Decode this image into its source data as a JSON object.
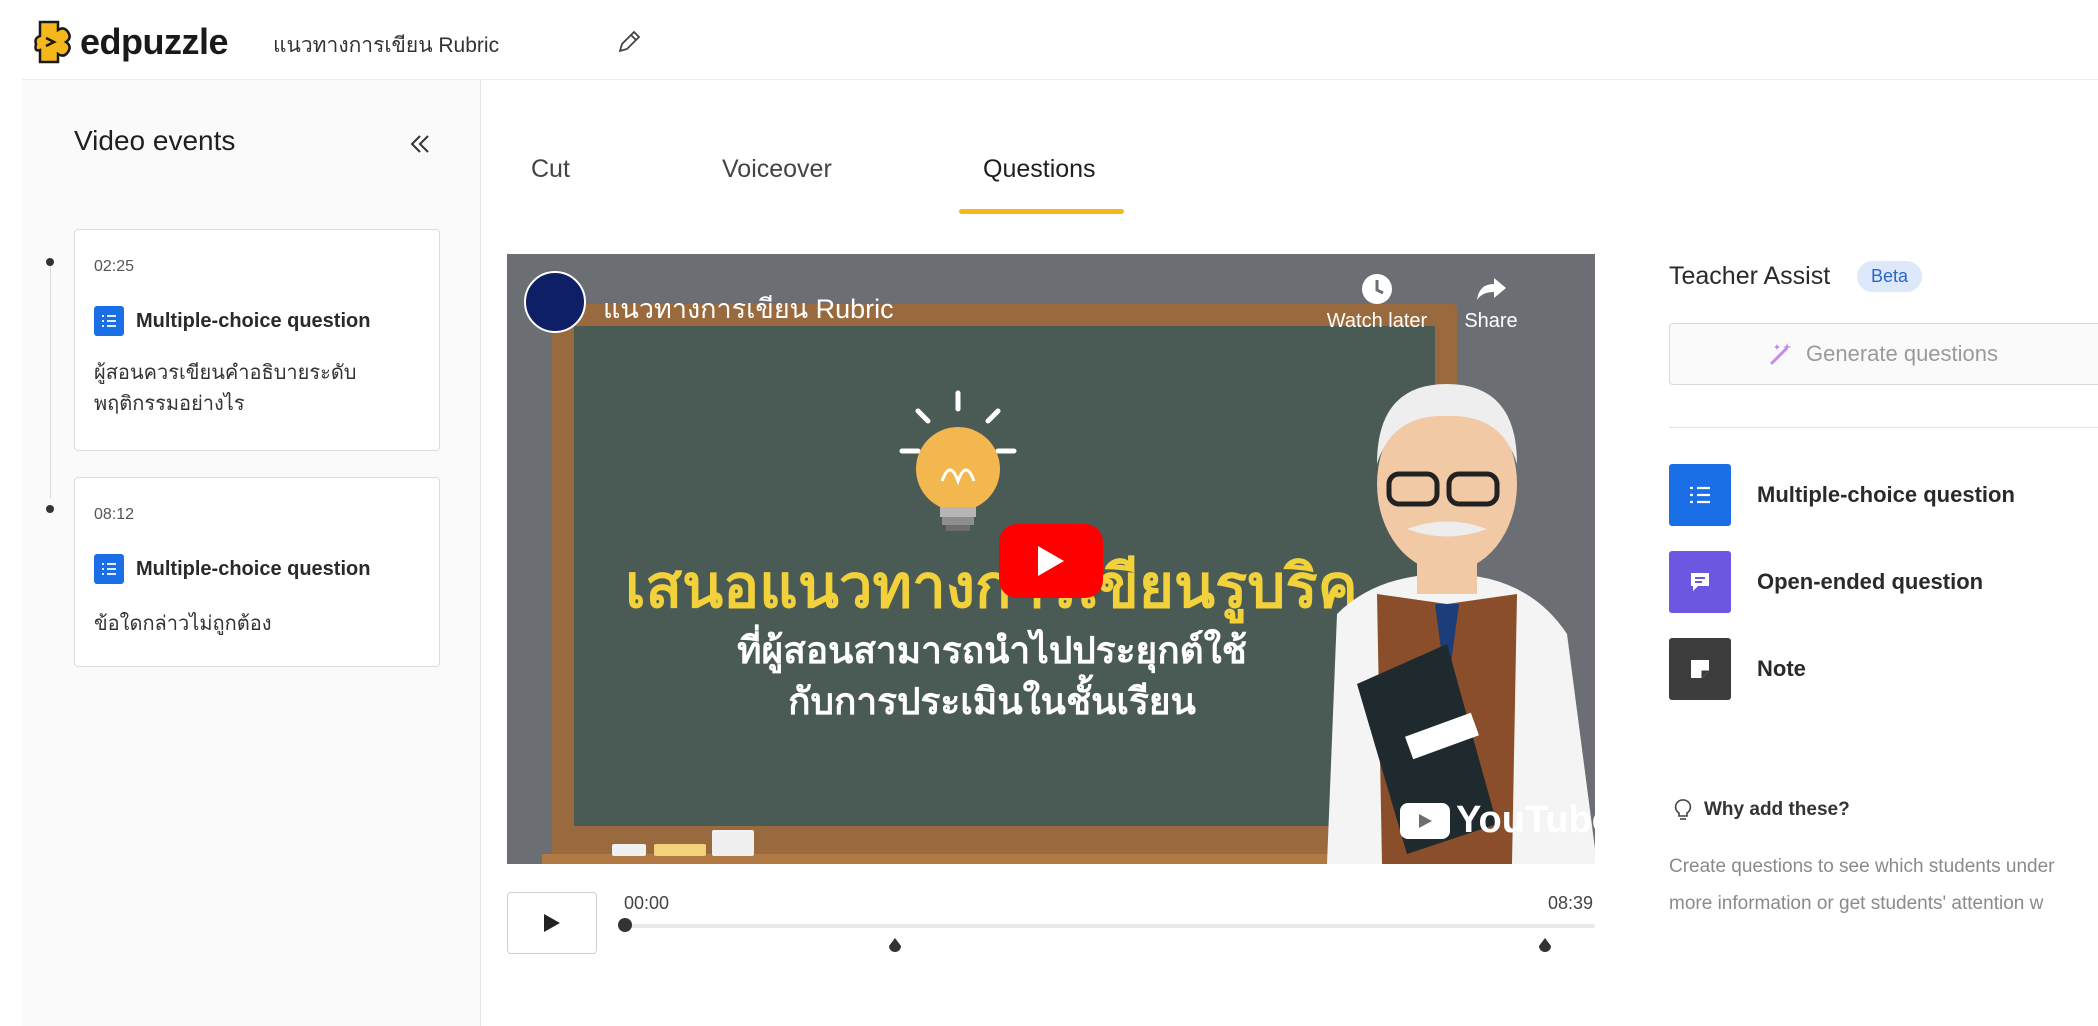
{
  "app": {
    "brand": "edpuzzle",
    "video_title": "แนวทางการเขียน Rubric"
  },
  "sidebar": {
    "title": "Video events",
    "events": [
      {
        "time": "02:25",
        "type": "Multiple-choice question",
        "text": "ผู้สอนควรเขียนคำอธิบายระดับพฤติกรรมอย่างไร"
      },
      {
        "time": "08:12",
        "type": "Multiple-choice question",
        "text": "ข้อใดกล่าวไม่ถูกต้อง"
      }
    ]
  },
  "tabs": [
    {
      "label": "Cut",
      "active": false
    },
    {
      "label": "Voiceover",
      "active": false
    },
    {
      "label": "Questions",
      "active": true
    }
  ],
  "video": {
    "title": "แนวทางการเขียน Rubric",
    "watch_later": "Watch later",
    "share": "Share",
    "headline": "เสนอแนวทางการเขียนรูบริค",
    "subline_1": "ที่ผู้สอนสามารถนำไปประยุกต์ใช้",
    "subline_2": "กับการประเมินในชั้นเรียน",
    "youtube": "YouTube"
  },
  "player": {
    "current_time": "00:00",
    "duration": "08:39",
    "progress": 0
  },
  "teacher_assist": {
    "title": "Teacher Assist",
    "badge": "Beta",
    "generate_label": "Generate questions"
  },
  "question_types": [
    {
      "label": "Multiple-choice question",
      "icon": "list-icon",
      "color": "#1a6fe6"
    },
    {
      "label": "Open-ended question",
      "icon": "comment-icon",
      "color": "#6b57e0"
    },
    {
      "label": "Note",
      "icon": "note-icon",
      "color": "#3d3d3d"
    }
  ],
  "info": {
    "title": "Why add these?",
    "line_1": "Create questions to see which students under",
    "line_2": "more information or get students' attention w"
  },
  "colors": {
    "accent_yellow": "#f5b81c",
    "primary_blue": "#1a6fe6",
    "youtube_red": "#ff0000"
  }
}
